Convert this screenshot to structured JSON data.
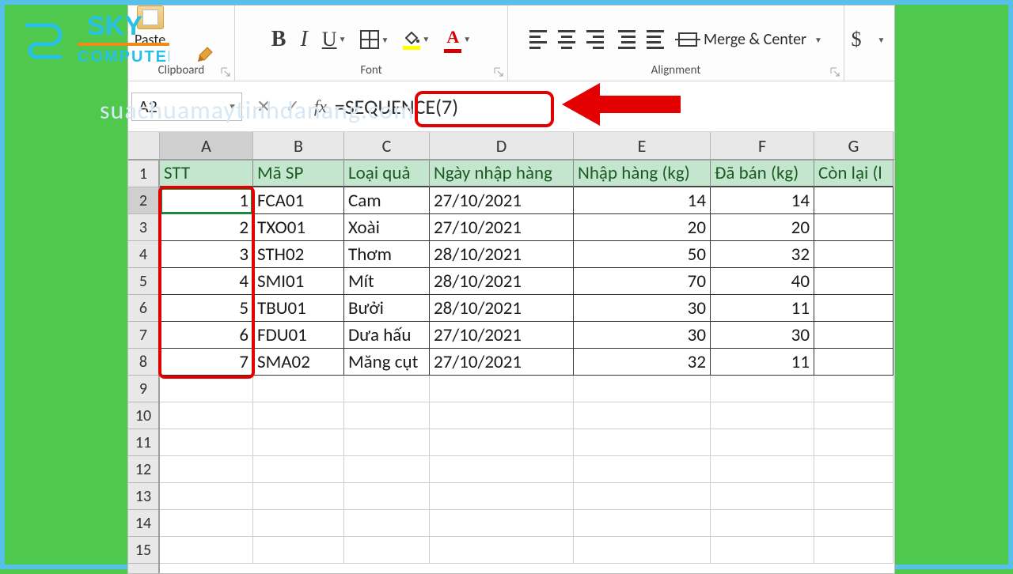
{
  "watermark": {
    "brand1": "SKY",
    "brand2": "COMPUTER",
    "url": "suachuamaytinhdanang.com"
  },
  "ribbon": {
    "paste_label": "Paste",
    "clipboard_group": "Clipboard",
    "font_group": "Font",
    "alignment_group": "Alignment",
    "bold": "B",
    "italic": "I",
    "underline": "U",
    "font_color_letter": "A",
    "merge_label": "Merge & Center",
    "currency": "$"
  },
  "formula_bar": {
    "name_box": "A2",
    "formula": "=SEQUENCE(7)"
  },
  "columns": [
    "A",
    "B",
    "C",
    "D",
    "E",
    "F",
    "G"
  ],
  "row_numbers": [
    "1",
    "2",
    "3",
    "4",
    "5",
    "6",
    "7",
    "8",
    "9",
    "10",
    "11",
    "12",
    "13",
    "14",
    "15"
  ],
  "headers": {
    "A": "STT",
    "B": "Mã SP",
    "C": "Loại quả",
    "D": "Ngày nhập hàng",
    "E": "Nhập hàng (kg)",
    "F": "Đã bán (kg)",
    "G": "Còn lại (l"
  },
  "rows": [
    {
      "A": "1",
      "B": "FCA01",
      "C": "Cam",
      "D": "27/10/2021",
      "E": "14",
      "F": "14"
    },
    {
      "A": "2",
      "B": "TXO01",
      "C": "Xoài",
      "D": "27/10/2021",
      "E": "20",
      "F": "20"
    },
    {
      "A": "3",
      "B": "STH02",
      "C": "Thơm",
      "D": "28/10/2021",
      "E": "50",
      "F": "32"
    },
    {
      "A": "4",
      "B": "SMI01",
      "C": "Mít",
      "D": "28/10/2021",
      "E": "70",
      "F": "40"
    },
    {
      "A": "5",
      "B": "TBU01",
      "C": "Bưởi",
      "D": "28/10/2021",
      "E": "30",
      "F": "11"
    },
    {
      "A": "6",
      "B": "FDU01",
      "C": "Dưa hấu",
      "D": "27/10/2021",
      "E": "30",
      "F": "30"
    },
    {
      "A": "7",
      "B": "SMA02",
      "C": "Măng cụt",
      "D": "27/10/2021",
      "E": "32",
      "F": "11"
    }
  ]
}
